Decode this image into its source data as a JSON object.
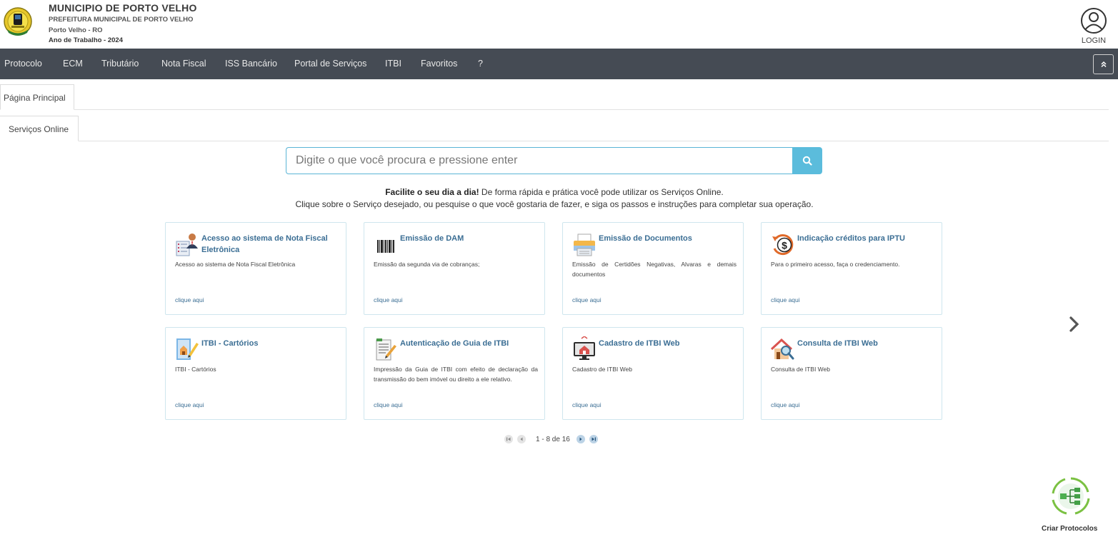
{
  "header": {
    "title": "MUNICIPIO DE PORTO VELHO",
    "subtitle": "PREFEITURA MUNICIPAL DE PORTO VELHO",
    "city": "Porto Velho - RO",
    "year": "Ano de Trabalho - 2024",
    "login_label": "LOGIN"
  },
  "nav": {
    "items": [
      "Protocolo",
      "ECM",
      "Tributário",
      "Nota Fiscal",
      "ISS Bancário",
      "Portal de Serviços",
      "ITBI",
      "Favoritos",
      "?"
    ],
    "collapse_icon": "double-chevron-up-icon"
  },
  "tabs": {
    "main": "Página Principal",
    "sub": "Serviços Online"
  },
  "search": {
    "placeholder": "Digite o que você procura e pressione enter",
    "value": ""
  },
  "intro": {
    "bold": "Facilite o seu dia a dia!",
    "line1": " De forma rápida e prática você pode utilizar os Serviços Online.",
    "line2": "Clique sobre o Serviço desejado, ou pesquise o que você gostaria de fazer, e siga os passos e instruções para completar sua operação."
  },
  "cards": [
    {
      "title": "Acesso ao sistema de Nota Fiscal Eletrônica",
      "desc": "Acesso ao sistema de Nota Fiscal Eletrônica",
      "link": "clique aqui",
      "icon": "person-document-icon"
    },
    {
      "title": "Emissão de DAM",
      "desc": "Emissão da segunda via de cobranças;",
      "link": "clique aqui",
      "icon": "barcode-icon"
    },
    {
      "title": "Emissão de Documentos",
      "desc": "Emissão de Certidões Negativas, Alvaras e demais documentos",
      "link": "clique aqui",
      "icon": "printer-icon"
    },
    {
      "title": "Indicação créditos para IPTU",
      "desc": "Para o primeiro acesso, faça o credenciamento.",
      "link": "clique aqui",
      "icon": "dollar-refresh-icon"
    },
    {
      "title": "ITBI - Cartórios",
      "desc": "ITBI - Cartórios",
      "link": "clique aqui",
      "icon": "house-document-pencil-icon"
    },
    {
      "title": "Autenticação de Guia de ITBI",
      "desc": "Impressão da Guia de ITBI com efeito de declaração da transmissão do bem imóvel ou direito a ele relativo.",
      "link": "clique aqui",
      "icon": "document-pen-icon"
    },
    {
      "title": "Cadastro de ITBI Web",
      "desc": "Cadastro de ITBI Web",
      "link": "clique aqui",
      "icon": "monitor-house-icon"
    },
    {
      "title": "Consulta de ITBI Web",
      "desc": "Consulta de ITBI Web",
      "link": "clique aqui",
      "icon": "house-magnifier-icon"
    }
  ],
  "pager": {
    "text": "1 - 8 de 16",
    "current_start": 1,
    "current_end": 8,
    "total": 16
  },
  "protocol": {
    "label": "Criar Protocolos"
  }
}
